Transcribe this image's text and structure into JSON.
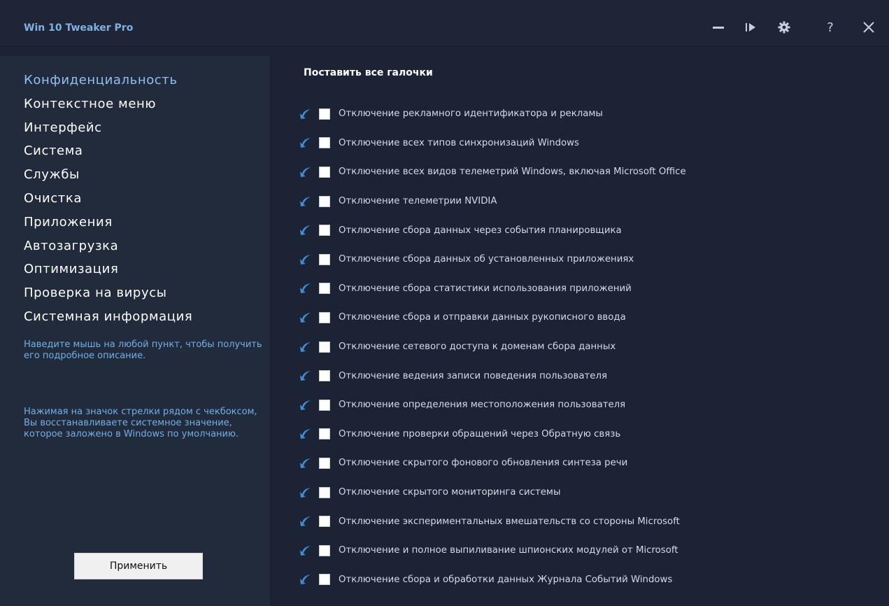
{
  "app": {
    "title": "Win 10 Tweaker Pro"
  },
  "titlebar_icons": [
    "minimize-icon",
    "play-icon",
    "gear-icon",
    "help-icon",
    "close-icon"
  ],
  "titlebar_glyphs": {
    "help": "?"
  },
  "sidebar": {
    "items": [
      {
        "label": "Конфиденциальность",
        "active": true
      },
      {
        "label": "Контекстное меню"
      },
      {
        "label": "Интерфейс"
      },
      {
        "label": "Система"
      },
      {
        "label": "Службы"
      },
      {
        "label": "Очистка"
      },
      {
        "label": "Приложения"
      },
      {
        "label": "Автозагрузка"
      },
      {
        "label": "Оптимизация"
      },
      {
        "label": "Проверка на вирусы"
      },
      {
        "label": "Системная информация"
      }
    ],
    "hint1": "Наведите мышь на любой пункт, чтобы получить его подробное описание.",
    "hint2": "Нажимая на значок стрелки рядом с чекбоксом, Вы восстанавливаете системное значение, которое заложено в Windows по умолчанию.",
    "apply_label": "Применить"
  },
  "main": {
    "check_all_label": "Поставить все галочки",
    "options": [
      {
        "label": "Отключение рекламного идентификатора и рекламы",
        "checked": false
      },
      {
        "label": "Отключение всех типов синхронизаций Windows",
        "checked": false
      },
      {
        "label": "Отключение всех видов телеметрий Windows, включая Microsoft Office",
        "checked": false
      },
      {
        "label": "Отключение телеметрии NVIDIA",
        "checked": false
      },
      {
        "label": "Отключение сбора данных через события планировщика",
        "checked": false
      },
      {
        "label": "Отключение сбора данных об установленных приложениях",
        "checked": false
      },
      {
        "label": "Отключение сбора статистики использования приложений",
        "checked": false
      },
      {
        "label": "Отключение сбора и отправки данных рукописного ввода",
        "checked": false
      },
      {
        "label": "Отключение сетевого доступа к доменам сбора данных",
        "checked": false
      },
      {
        "label": "Отключение ведения записи поведения пользователя",
        "checked": false
      },
      {
        "label": "Отключение определения местоположения пользователя",
        "checked": false
      },
      {
        "label": "Отключение проверки обращений через Обратную связь",
        "checked": false
      },
      {
        "label": "Отключение скрытого фонового обновления синтеза речи",
        "checked": false
      },
      {
        "label": "Отключение скрытого мониторинга системы",
        "checked": false
      },
      {
        "label": "Отключение экспериментальных вмешательств со стороны Microsoft",
        "checked": false
      },
      {
        "label": "Отключение и полное выпиливание шпионских модулей от Microsoft",
        "checked": false
      },
      {
        "label": "Отключение сбора и обработки данных Журнала Событий Windows",
        "checked": false
      }
    ]
  },
  "colors": {
    "background": "#1b2334",
    "sidebar": "#222b3c",
    "accent": "#7fb0e0",
    "hint": "#6fb0e8",
    "restore_icon": "#3f8fd8"
  }
}
